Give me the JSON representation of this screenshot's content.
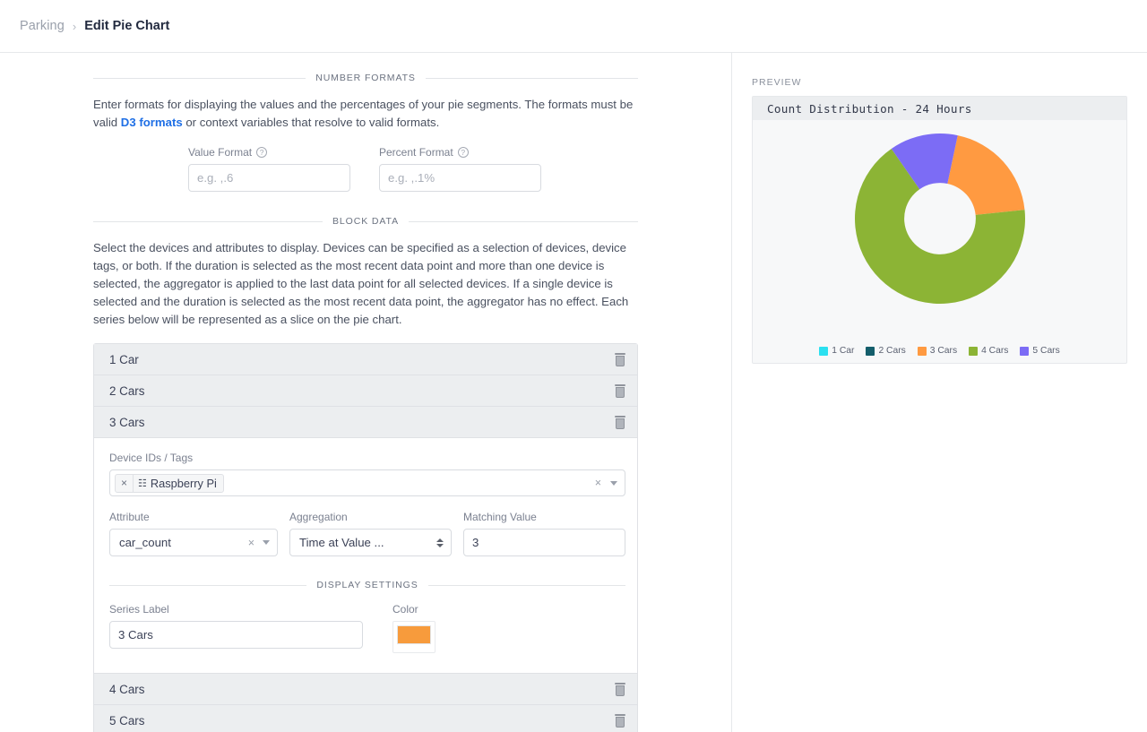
{
  "breadcrumb": {
    "parent": "Parking",
    "separator": "›",
    "current": "Edit Pie Chart"
  },
  "number_formats": {
    "section_title": "NUMBER FORMATS",
    "description_before": "Enter formats for displaying the values and the percentages of your pie segments. The formats must be valid ",
    "link_text": "D3 formats",
    "description_after": " or context variables that resolve to valid formats.",
    "value_format": {
      "label": "Value Format",
      "help_icon": "question-circle-icon",
      "value": "",
      "placeholder": "e.g. ,.6"
    },
    "percent_format": {
      "label": "Percent Format",
      "help_icon": "question-circle-icon",
      "value": "",
      "placeholder": "e.g. ,.1%"
    }
  },
  "block_data": {
    "section_title": "BLOCK DATA",
    "description": "Select the devices and attributes to display. Devices can be specified as a selection of devices, device tags, or both. If the duration is selected as the most recent data point and more than one device is selected, the aggregator is applied to the last data point for all selected devices. If a single device is selected and the duration is selected as the most recent data point, the aggregator has no effect. Each series below will be represented as a slice on the pie chart.",
    "series": [
      {
        "label": "1 Car",
        "expanded": false,
        "delete_icon": "trash-icon"
      },
      {
        "label": "2 Cars",
        "expanded": false,
        "delete_icon": "trash-icon"
      },
      {
        "label": "3 Cars",
        "expanded": true,
        "delete_icon": "trash-icon"
      },
      {
        "label": "4 Cars",
        "expanded": false,
        "delete_icon": "trash-icon"
      },
      {
        "label": "5 Cars",
        "expanded": false,
        "delete_icon": "trash-icon"
      }
    ]
  },
  "expanded_series": {
    "device_ids": {
      "label": "Device IDs / Tags",
      "chips": [
        {
          "text": "Raspberry Pi",
          "icon": "microchip-icon",
          "remove": "×"
        }
      ],
      "clear_all": "×",
      "dropdown_icon": "chevron-down-icon"
    },
    "attribute": {
      "label": "Attribute",
      "value": "car_count",
      "clear": "×",
      "dropdown_icon": "chevron-down-icon"
    },
    "aggregation": {
      "label": "Aggregation",
      "value": "Time at Value ...",
      "stepper_icon": "up-down-arrows-icon"
    },
    "matching_value": {
      "label": "Matching Value",
      "value": "3"
    },
    "display_settings": {
      "section_title": "DISPLAY SETTINGS",
      "series_label": {
        "label": "Series Label",
        "value": "3 Cars"
      },
      "color": {
        "label": "Color",
        "value": "#F79B3C"
      }
    }
  },
  "preview": {
    "label": "PREVIEW",
    "chart_title": "Count Distribution - 24 Hours"
  },
  "chart_data": {
    "type": "pie",
    "title": "Count Distribution - 24 Hours",
    "donut": true,
    "inner_radius_ratio": 0.42,
    "legend_position": "bottom",
    "categories": [
      "1 Car",
      "2 Cars",
      "3 Cars",
      "4 Cars",
      "5 Cars"
    ],
    "values": [
      0,
      0,
      20,
      67,
      13
    ],
    "colors": [
      "#2BE0F0",
      "#145E6B",
      "#FF9A41",
      "#8CB435",
      "#7C6CF5"
    ],
    "series": [
      {
        "name": "1 Car",
        "value": 0,
        "color": "#2BE0F0"
      },
      {
        "name": "2 Cars",
        "value": 0,
        "color": "#145E6B"
      },
      {
        "name": "3 Cars",
        "value": 20,
        "color": "#FF9A41"
      },
      {
        "name": "4 Cars",
        "value": 67,
        "color": "#8CB435"
      },
      {
        "name": "5 Cars",
        "value": 13,
        "color": "#7C6CF5"
      }
    ]
  }
}
